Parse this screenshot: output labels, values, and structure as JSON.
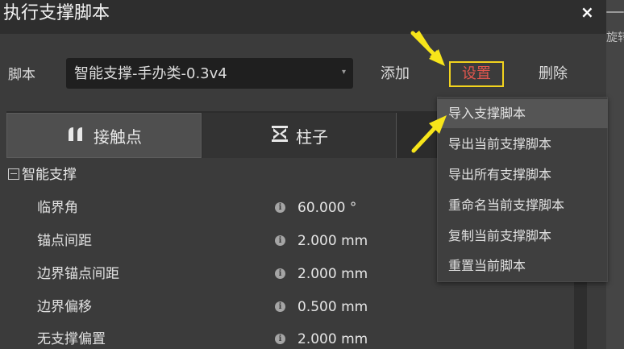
{
  "dialog": {
    "title": "执行支撑脚本",
    "close_glyph": "×"
  },
  "background": {
    "partial_text": "旋转"
  },
  "script_row": {
    "label": "脚本",
    "selected": "智能支撑-手办类-0.3v4",
    "add_label": "添加",
    "settings_label": "设置",
    "delete_label": "删除"
  },
  "tabs": [
    {
      "label": "接触点",
      "icon": "contact-point-icon",
      "active": true
    },
    {
      "label": "柱子",
      "icon": "pillar-icon",
      "active": false
    }
  ],
  "section": {
    "title": "智能支撑",
    "expanded": true
  },
  "properties": [
    {
      "label": "临界角",
      "value": "60.000 °"
    },
    {
      "label": "锚点间距",
      "value": "2.000 mm"
    },
    {
      "label": "边界锚点间距",
      "value": "2.000 mm"
    },
    {
      "label": "边界偏移",
      "value": "0.500 mm"
    },
    {
      "label": "无支撑偏置",
      "value": "2.000 mm"
    }
  ],
  "menu": {
    "items": [
      {
        "label": "导入支撑脚本",
        "highlighted": true
      },
      {
        "label": "导出当前支撑脚本",
        "highlighted": false
      },
      {
        "label": "导出所有支撑脚本",
        "highlighted": false
      },
      {
        "label": "重命名当前支撑脚本",
        "highlighted": false
      },
      {
        "label": "复制当前支撑脚本",
        "highlighted": false
      },
      {
        "label": "重置当前脚本",
        "highlighted": false
      }
    ]
  },
  "colors": {
    "highlight_border": "#f2d31e",
    "settings_text": "#e2564e",
    "annotation_arrow": "#f7e51a"
  }
}
